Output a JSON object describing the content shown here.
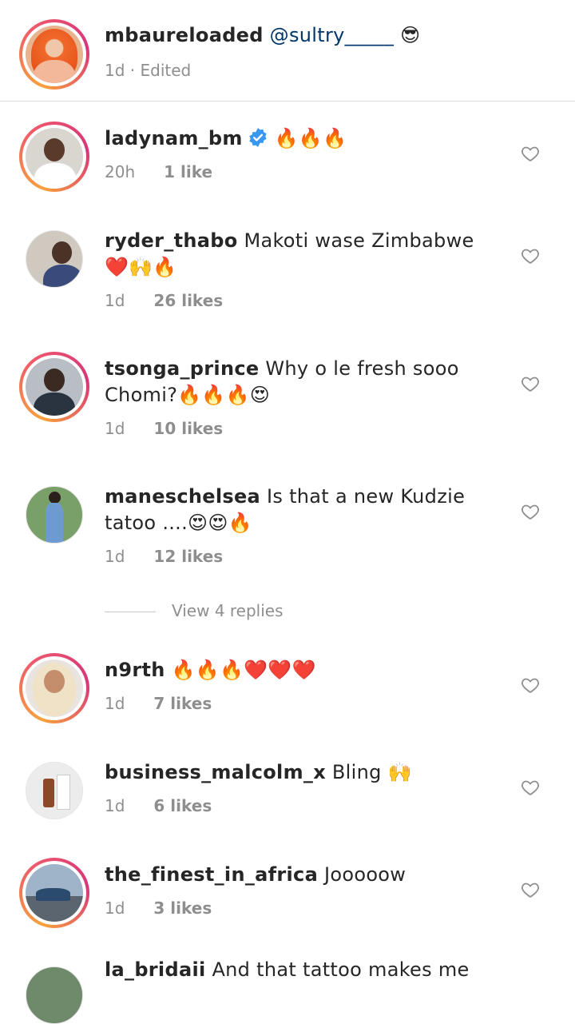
{
  "caption": {
    "username": "mbaureloaded",
    "mention": "@sultry_____",
    "emoji": "😎",
    "time": "1d",
    "separator": " · ",
    "edited": "Edited"
  },
  "comments": [
    {
      "username": "ladynam_bm",
      "verified": true,
      "text": "🔥🔥🔥",
      "text2": "",
      "time": "20h",
      "likes": "1 like"
    },
    {
      "username": "ryder_thabo",
      "verified": false,
      "text": "Makoti wase Zimbabwe",
      "text2": "❤️🙌🔥",
      "time": "1d",
      "likes": "26 likes"
    },
    {
      "username": "tsonga_prince",
      "verified": false,
      "text": "Why o le fresh sooo",
      "text2": "Chomi?🔥🔥🔥😍",
      "time": "1d",
      "likes": "10 likes"
    },
    {
      "username": "maneschelsea",
      "verified": false,
      "text": "Is that a new  Kudzie",
      "text2": "tatoo ....😍😍🔥",
      "time": "1d",
      "likes": "12 likes"
    },
    {
      "username": "n9rth",
      "verified": false,
      "text": "🔥🔥🔥❤️❤️❤️",
      "text2": "",
      "time": "1d",
      "likes": "7 likes"
    },
    {
      "username": "business_malcolm_x",
      "verified": false,
      "text": "Bling 🙌",
      "text2": "",
      "time": "1d",
      "likes": "6 likes"
    },
    {
      "username": "the_finest_in_africa",
      "verified": false,
      "text": "Jooooow",
      "text2": "",
      "time": "1d",
      "likes": "3 likes"
    },
    {
      "username": "la_bridaii",
      "verified": false,
      "text": "And that tattoo makes me",
      "text2": "",
      "time": "",
      "likes": ""
    }
  ],
  "view_replies": "View 4 replies",
  "colors": {
    "link": "#00376b",
    "meta": "#8e8e8e",
    "verified": "#3897f0",
    "divider": "#dbdbdb"
  }
}
